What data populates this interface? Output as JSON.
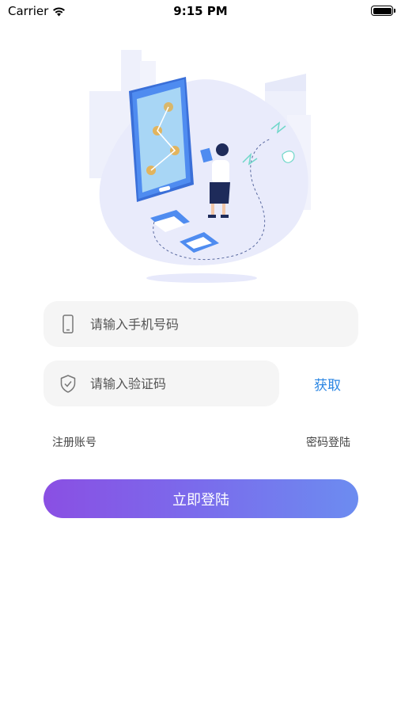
{
  "status_bar": {
    "carrier": "Carrier",
    "time": "9:15 PM"
  },
  "form": {
    "phone_placeholder": "请输入手机号码",
    "code_placeholder": "请输入验证码",
    "get_code_label": "获取",
    "register_link": "注册账号",
    "password_login_link": "密码登陆",
    "submit_label": "立即登陆"
  },
  "colors": {
    "accent": "#2b86e3",
    "button_gradient_start": "#8a4fe3",
    "button_gradient_end": "#6c8cf0",
    "input_bg": "#f5f5f5"
  }
}
